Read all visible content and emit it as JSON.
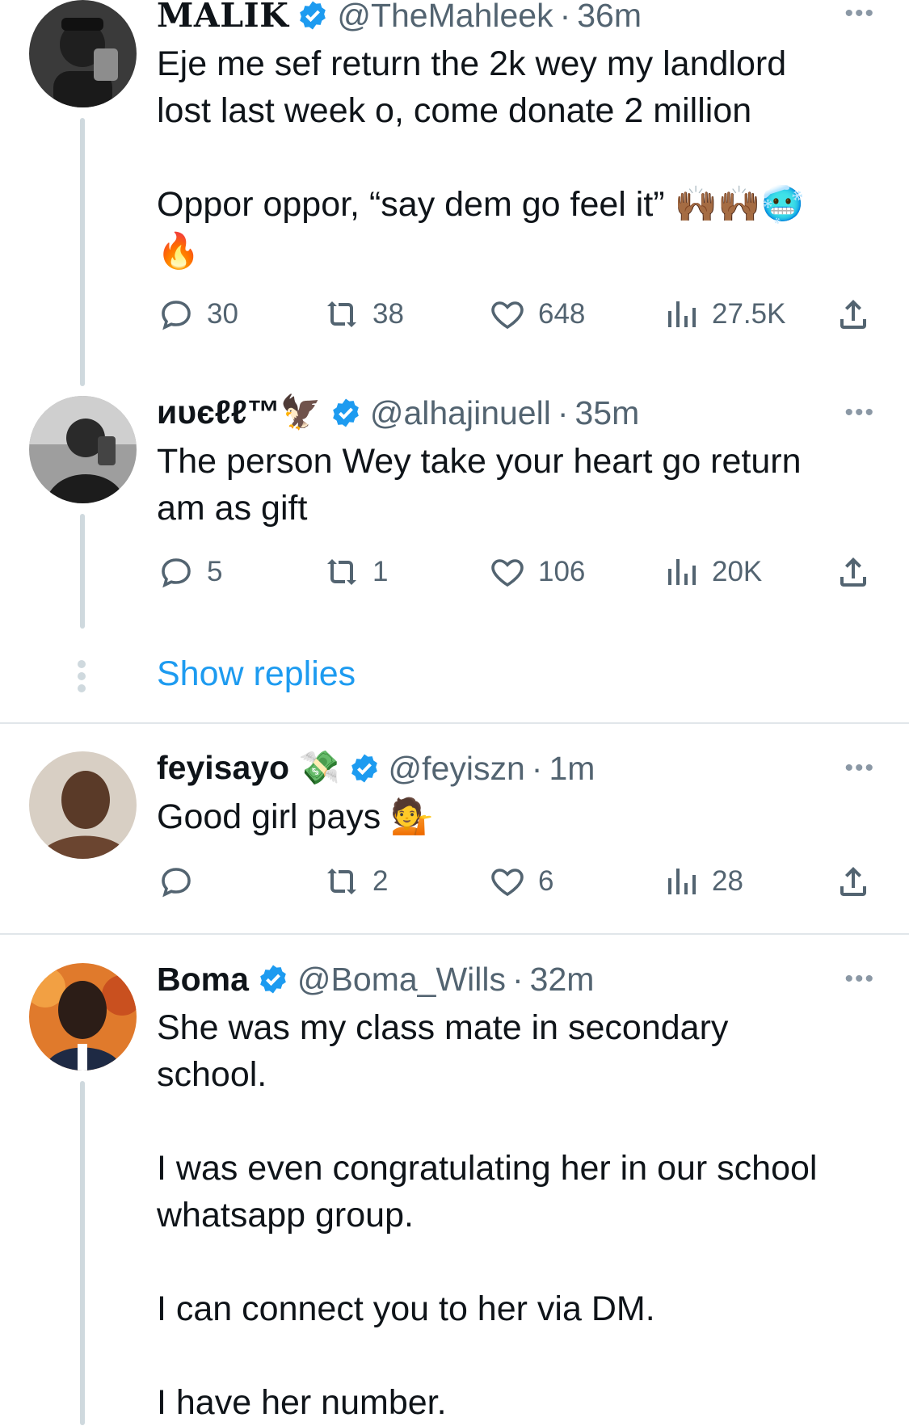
{
  "tweets": [
    {
      "name": "MALIK",
      "handle": "@TheMahleek",
      "time": "36m",
      "text": "Eje me sef return the 2k wey my landlord\nlost last week o, come donate 2 million\n\nOppor oppor, “say dem go feel it” 🙌🏾🙌🏾🥶\n🔥",
      "replies": "30",
      "retweets": "38",
      "likes": "648",
      "views": "27.5K",
      "avatar_colors": [
        "#2b2b2b",
        "#7a7a7a"
      ]
    },
    {
      "name": "иυєℓℓ™🦅",
      "handle": "@alhajinuell",
      "time": "35m",
      "text": "The person Wey take your heart go return\nam as gift",
      "replies": "5",
      "retweets": "1",
      "likes": "106",
      "views": "20K",
      "avatar_colors": [
        "#3a3a3a",
        "#bdbdbd"
      ]
    },
    {
      "name": "feyisayo 💸",
      "handle": "@feyiszn",
      "time": "1m",
      "text": "Good girl pays 💁",
      "replies": "",
      "retweets": "2",
      "likes": "6",
      "views": "28",
      "avatar_colors": [
        "#5a3a28",
        "#c9a98a"
      ]
    },
    {
      "name": "Boma",
      "handle": "@Boma_Wills",
      "time": "32m",
      "text": "She was my class mate in secondary\nschool.\n\nI was even congratulating her in our school\nwhatsapp group.\n\nI can connect you to her via DM.\n\nI have her number.",
      "avatar_colors": [
        "#2c1d17",
        "#e07a2c"
      ]
    }
  ],
  "show_replies": "Show replies",
  "more_glyph": "•••",
  "colors": {
    "accent": "#1d9bf0",
    "secondary": "#536471",
    "line": "#cfd9de"
  }
}
